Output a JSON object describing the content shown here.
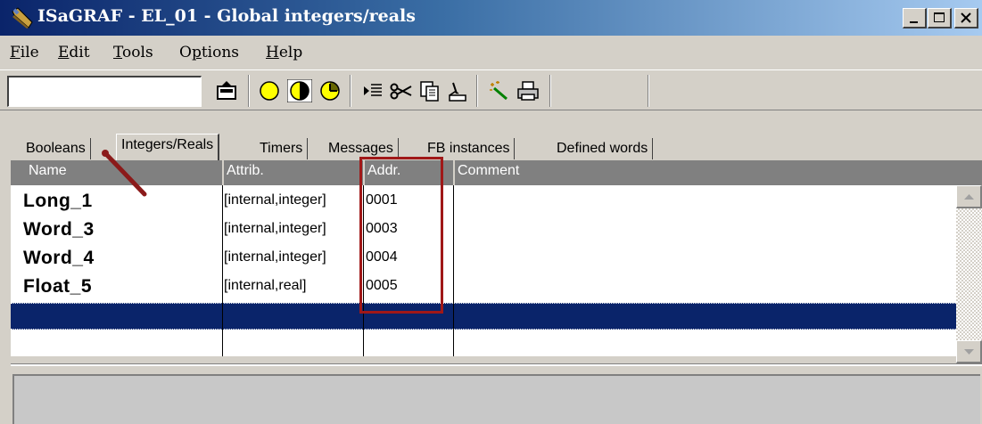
{
  "window": {
    "title": "ISaGRAF - EL_01 - Global integers/reals",
    "controls": [
      "minimize-icon",
      "maximize-icon",
      "close-icon"
    ]
  },
  "menubar": {
    "items": [
      {
        "label": "File",
        "mnemonic": "F",
        "rest": "ile"
      },
      {
        "label": "Edit",
        "mnemonic": "E",
        "rest": "dit"
      },
      {
        "label": "Tools",
        "mnemonic": "T",
        "rest": "ools"
      },
      {
        "label": "Options",
        "mnemonic": "p",
        "pre": "O",
        "rest": "tions"
      },
      {
        "label": "Help",
        "mnemonic": "H",
        "rest": "elp"
      }
    ]
  },
  "toolbar": {
    "field_value": "",
    "icons": [
      "export-icon",
      "circle-empty-icon",
      "circle-half-icon",
      "circle-quarter-icon",
      "insert-lines-icon",
      "cut-icon",
      "copy-icon",
      "paste-icon",
      "magic-wand-icon",
      "print-icon"
    ]
  },
  "tabs": [
    {
      "label": "Booleans",
      "active": false
    },
    {
      "label": "Integers/Reals",
      "active": true
    },
    {
      "label": "Timers",
      "active": false
    },
    {
      "label": "Messages",
      "active": false
    },
    {
      "label": "FB instances",
      "active": false
    },
    {
      "label": "Defined words",
      "active": false
    }
  ],
  "table": {
    "columns": [
      "Name",
      "Attrib.",
      "Addr.",
      "Comment"
    ],
    "rows": [
      {
        "name": "Long_1",
        "attrib": "[internal,integer]",
        "addr": "0001",
        "comment": ""
      },
      {
        "name": "Word_3",
        "attrib": "[internal,integer]",
        "addr": "0003",
        "comment": ""
      },
      {
        "name": "Word_4",
        "attrib": "[internal,integer]",
        "addr": "0004",
        "comment": ""
      },
      {
        "name": "Float_5",
        "attrib": "[internal,real]",
        "addr": "0005",
        "comment": ""
      }
    ]
  },
  "colors": {
    "titlebar_start": "#0a246a",
    "titlebar_end": "#a6caf0",
    "selection": "#0a246a",
    "header_bg": "#808080",
    "annotation": "#a01818"
  }
}
